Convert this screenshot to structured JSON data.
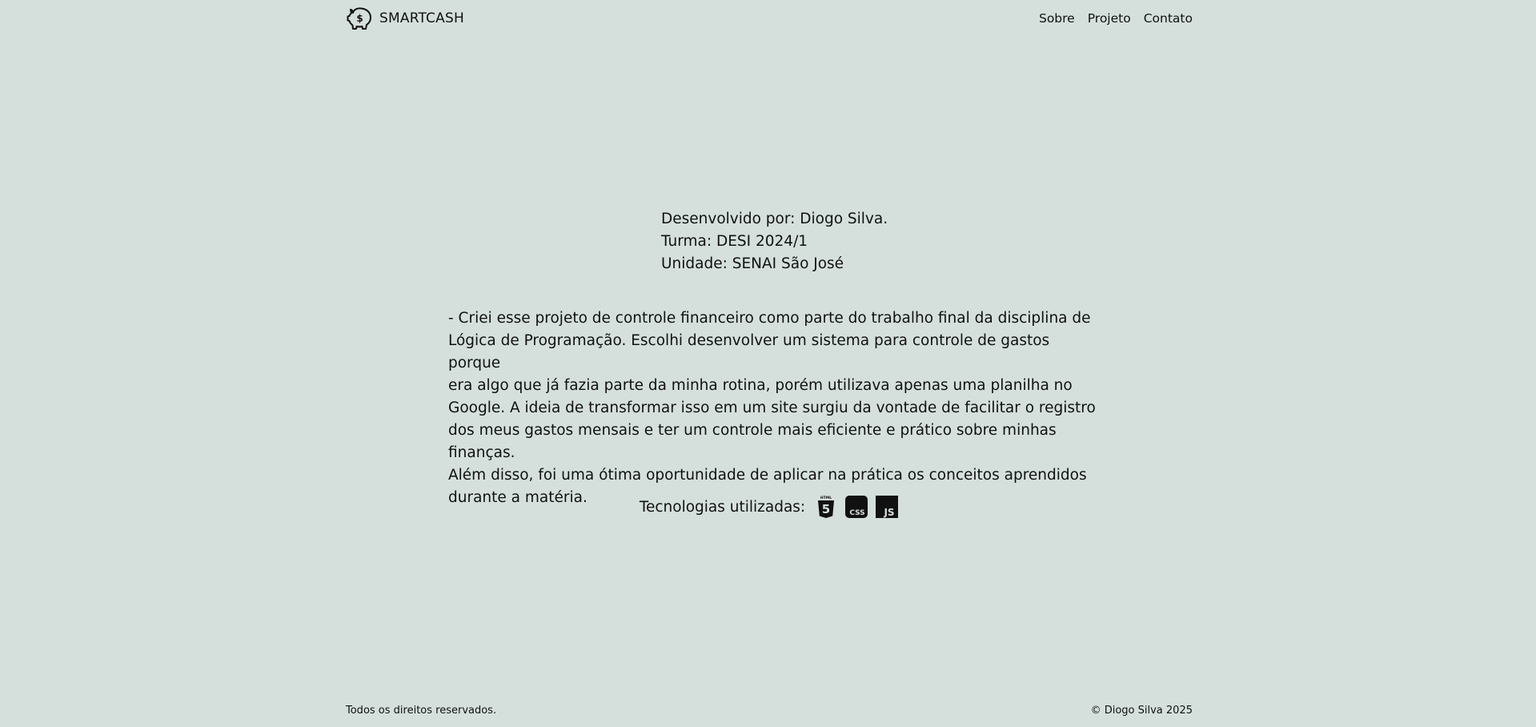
{
  "header": {
    "brand": "SMARTCASH",
    "brand_icon": "piggy-bank-dollar-icon",
    "nav": [
      {
        "label": "Sobre"
      },
      {
        "label": "Projeto"
      },
      {
        "label": "Contato"
      }
    ]
  },
  "credits": {
    "developer": "Desenvolvido por: Diogo Silva.",
    "class": "Turma: DESI 2024/1",
    "unit": "Unidade: SENAI São José"
  },
  "description": {
    "lines": [
      "- Criei esse projeto de controle financeiro como parte do trabalho final da disciplina de",
      "Lógica de Programação. Escolhi desenvolver um sistema para controle de gastos porque",
      "era algo que já fazia parte da minha rotina, porém utilizava apenas uma planilha no",
      "Google. A ideia de transformar isso em um site surgiu da vontade de facilitar o registro",
      "dos meus gastos mensais e ter um controle mais eficiente e prático sobre minhas finanças.",
      "Além disso, foi uma ótima oportunidade de aplicar na prática os conceitos aprendidos",
      "durante a matéria."
    ]
  },
  "technologies": {
    "label": "Tecnologias utilizadas:",
    "icons": [
      "html5-icon",
      "css3-icon",
      "javascript-icon"
    ],
    "html_badge": "HTML",
    "html_number": "5",
    "css_text": "CSS",
    "js_text": "JS"
  },
  "footer": {
    "left": "Todos os direitos reservados.",
    "right": "© Diogo Silva 2025"
  }
}
